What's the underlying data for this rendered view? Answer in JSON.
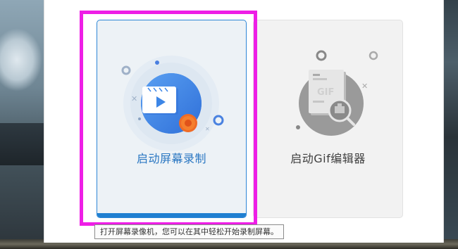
{
  "cards": [
    {
      "label": "启动屏幕录制",
      "icon": "video-recorder-icon",
      "accent": "#2a77c2"
    },
    {
      "label": "启动Gif编辑器",
      "icon": "gif-search-icon",
      "accent": "#3f3f3f"
    }
  ],
  "tooltip": {
    "text": "打开屏幕录像机，您可以在其中轻松开始录制屏幕。"
  },
  "highlight_color": "#ee1ee6"
}
